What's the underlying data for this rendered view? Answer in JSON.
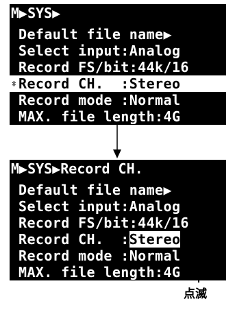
{
  "screen_before": {
    "breadcrumb": "M▶SYS▶",
    "rows": [
      {
        "label": "Default file name▶"
      },
      {
        "label": "Select input:Analog"
      },
      {
        "label": "Record FS/bit:44k/16"
      },
      {
        "label": "Record CH.  :Stereo",
        "cursor": "⇳"
      },
      {
        "label": "Record mode :Normal"
      },
      {
        "label": "MAX. file length:4G"
      }
    ]
  },
  "screen_after": {
    "breadcrumb": "M▶SYS▶Record CH.",
    "rows": [
      {
        "label": "Default file name▶"
      },
      {
        "label": "Select input:Analog"
      },
      {
        "label": "Record FS/bit:44k/16"
      },
      {
        "prefix": "Record CH.  :",
        "value": "Stereo"
      },
      {
        "label": "Record mode :Normal"
      },
      {
        "label": "MAX. file length:4G"
      }
    ]
  },
  "callout": {
    "label": "点滅"
  },
  "colors": {
    "lcd_background": "#000000",
    "lcd_text": "#ffffff",
    "highlight_background": "#ffffff",
    "highlight_text": "#000000"
  },
  "icons": {
    "transition_arrow": "down-arrow-icon",
    "scroll_cursor": "up-down-cursor-icon"
  }
}
